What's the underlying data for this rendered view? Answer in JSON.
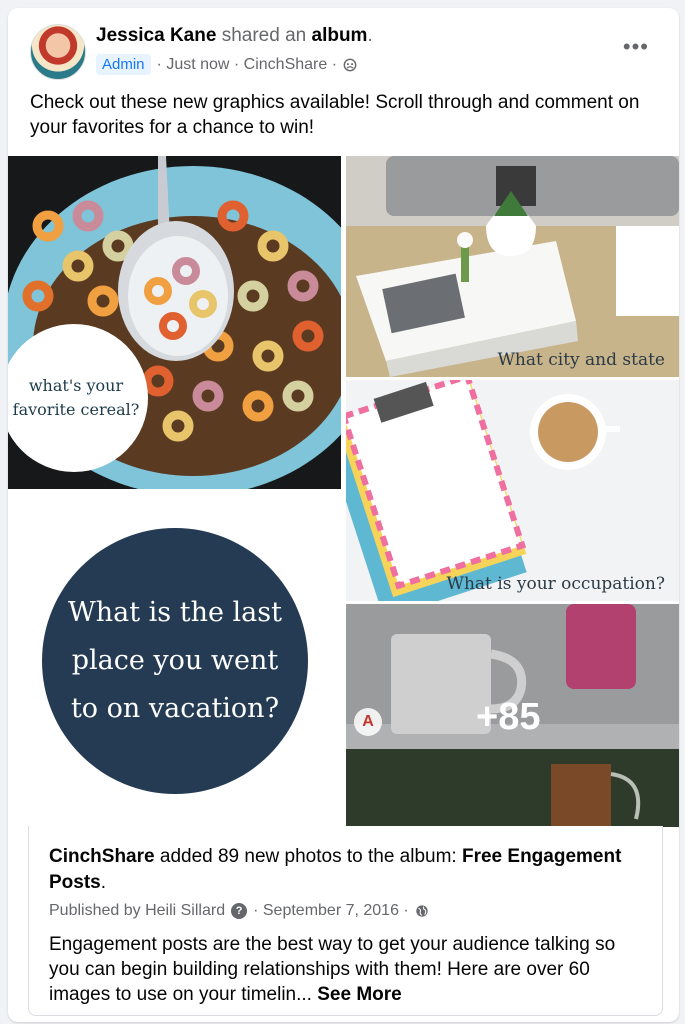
{
  "post": {
    "author": "Jessica Kane",
    "action_text": "shared an",
    "object_link": "album",
    "period": ".",
    "badge": "Admin",
    "timestamp": "Just now",
    "page": "CinchShare",
    "audience_icon": "group-icon",
    "menu_icon": "more-options-icon",
    "menu_label": "•••",
    "text": "Check out these new graphics available! Scroll through and comment on your favorites for a chance to win!"
  },
  "album": {
    "tiles": [
      {
        "caption": "what's your favorite cereal?"
      },
      {
        "caption": "What city and state"
      },
      {
        "caption": "What is your occupation?"
      },
      {
        "caption": "What is the last place you went to on vacation?"
      },
      {
        "caption": "+85"
      }
    ],
    "watermark": "A"
  },
  "preview": {
    "source": "CinchShare",
    "added_text": " added 89 new photos to the album: ",
    "album_title": "Free Engagement Posts",
    "period": ".",
    "published_by": "Published by Heili Sillard",
    "date": "September 7, 2016",
    "description": "Engagement posts are the best way to get your audience talking so you can begin building relationships with them! Here are over 60 images to use on your timelin...",
    "see_more": "See More"
  },
  "colors": {
    "link_blue": "#1877f2",
    "muted_text": "#65676b",
    "vacation_circle": "#243b53"
  }
}
